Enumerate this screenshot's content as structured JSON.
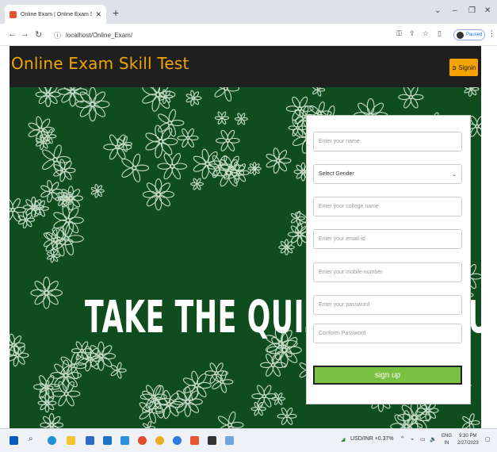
{
  "browser": {
    "tab_title": "Online Exam | Online Exam Skill",
    "url": "localhost/Online_Exam/",
    "paused_label": "Paused"
  },
  "app": {
    "brand": "Online Exam Skill Test",
    "signin_label": "Signin"
  },
  "hero": {
    "quiz_text": "TAKE THE QUIZ",
    "quiz_partial": "UI"
  },
  "form": {
    "name_placeholder": "Enter your name",
    "gender_value": "Select Gender",
    "college_placeholder": "Enter your college name",
    "email_placeholder": "Enter your email-id",
    "mobile_placeholder": "Enter your mobile number",
    "password_placeholder": "Enter your password",
    "confirm_placeholder": "Conform Password",
    "signup_label": "sign up"
  },
  "taskbar": {
    "stock": "USD/INR +0.37%",
    "lang1": "ENG",
    "lang2": "IN",
    "time": "9:30 PM",
    "date": "2/27/2023"
  },
  "colors": {
    "header_bg": "#1f1f1f",
    "brand": "#f0a500",
    "hero_bg": "#0f4d1e",
    "signup": "#7ac143"
  }
}
